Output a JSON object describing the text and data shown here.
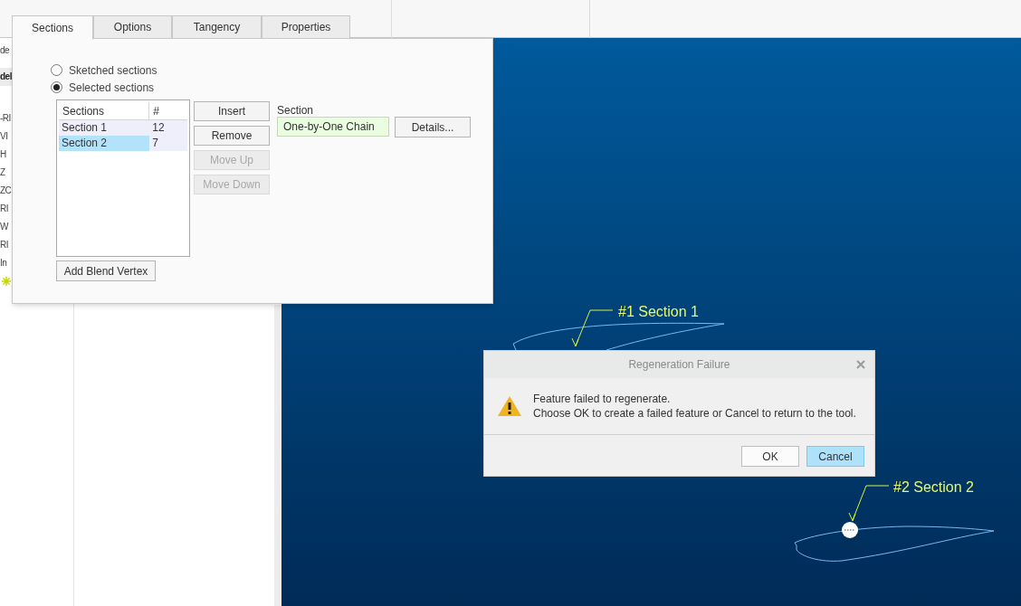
{
  "left_pane": {
    "fragments": [
      {
        "text": "de",
        "bold": false
      },
      {
        "text": "del",
        "bold": true
      },
      {
        "text": "-RI",
        "bold": false
      },
      {
        "text": "VI",
        "bold": false
      },
      {
        "text": "H",
        "bold": false
      },
      {
        "text": "Z",
        "bold": false
      },
      {
        "text": "ZC",
        "bold": false
      },
      {
        "text": "RI",
        "bold": false
      },
      {
        "text": "W",
        "bold": false
      },
      {
        "text": "RI",
        "bold": false
      },
      {
        "text": "In",
        "bold": false
      }
    ]
  },
  "tabs": [
    {
      "label": "Sections",
      "selected": true
    },
    {
      "label": "Options",
      "selected": false
    },
    {
      "label": "Tangency",
      "selected": false
    },
    {
      "label": "Properties",
      "selected": false
    }
  ],
  "section_mode": [
    {
      "label": "Sketched sections",
      "selected": false
    },
    {
      "label": "Selected sections",
      "selected": true
    }
  ],
  "sections_table": {
    "columns": [
      "Sections",
      "#"
    ],
    "rows": [
      {
        "cells": [
          "Section 1",
          "12"
        ],
        "selected": false
      },
      {
        "cells": [
          "Section 2",
          "7"
        ],
        "selected": true
      }
    ]
  },
  "list_buttons": [
    {
      "label": "Insert",
      "disabled": false
    },
    {
      "label": "Remove",
      "disabled": false
    },
    {
      "label": "Move Up",
      "disabled": true
    },
    {
      "label": "Move Down",
      "disabled": true
    }
  ],
  "add_blend_vertex_button": "Add Blend Vertex",
  "section": {
    "label": "Section",
    "chain": "One-by-One Chain",
    "details_button": "Details..."
  },
  "canvas": {
    "section_labels": [
      "#1 Section 1",
      "#2 Section 2"
    ]
  },
  "dialog": {
    "title": "Regeneration Failure",
    "message": [
      "Feature failed to regenerate.",
      "Choose OK to create a failed feature or Cancel to return to the tool."
    ],
    "buttons": [
      {
        "label": "OK",
        "selected": false
      },
      {
        "label": "Cancel",
        "selected": true
      }
    ]
  }
}
